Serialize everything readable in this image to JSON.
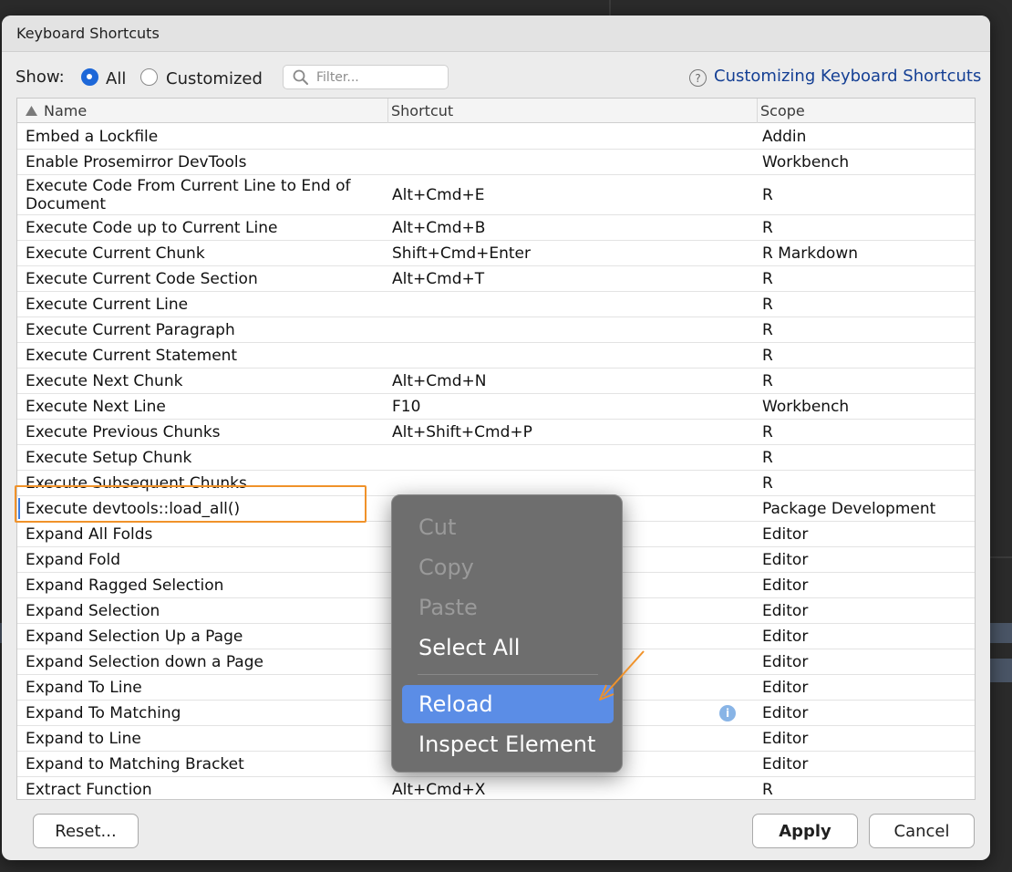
{
  "dialog": {
    "title": "Keyboard Shortcuts"
  },
  "toolbar": {
    "show_label": "Show:",
    "radio_all": "All",
    "radio_customized": "Customized",
    "filter_placeholder": "Filter...",
    "help_link": "Customizing Keyboard Shortcuts"
  },
  "table": {
    "columns": [
      "Name",
      "Shortcut",
      "Scope"
    ],
    "rows": [
      {
        "name": "Embed a Lockfile",
        "shortcut": "",
        "scope": "Addin"
      },
      {
        "name": "Enable Prosemirror DevTools",
        "shortcut": "",
        "scope": "Workbench"
      },
      {
        "name": "Execute Code From Current Line to End of Document",
        "shortcut": "Alt+Cmd+E",
        "scope": "R"
      },
      {
        "name": "Execute Code up to Current Line",
        "shortcut": "Alt+Cmd+B",
        "scope": "R"
      },
      {
        "name": "Execute Current Chunk",
        "shortcut": "Shift+Cmd+Enter",
        "scope": "R Markdown"
      },
      {
        "name": "Execute Current Code Section",
        "shortcut": "Alt+Cmd+T",
        "scope": "R"
      },
      {
        "name": "Execute Current Line",
        "shortcut": "",
        "scope": "R"
      },
      {
        "name": "Execute Current Paragraph",
        "shortcut": "",
        "scope": "R"
      },
      {
        "name": "Execute Current Statement",
        "shortcut": "",
        "scope": "R"
      },
      {
        "name": "Execute Next Chunk",
        "shortcut": "Alt+Cmd+N",
        "scope": "R"
      },
      {
        "name": "Execute Next Line",
        "shortcut": "F10",
        "scope": "Workbench"
      },
      {
        "name": "Execute Previous Chunks",
        "shortcut": "Alt+Shift+Cmd+P",
        "scope": "R"
      },
      {
        "name": "Execute Setup Chunk",
        "shortcut": "",
        "scope": "R"
      },
      {
        "name": "Execute Subsequent Chunks",
        "shortcut": "",
        "scope": "R"
      },
      {
        "name": "Execute devtools::load_all()",
        "shortcut": "",
        "scope": "Package Development"
      },
      {
        "name": "Expand All Folds",
        "shortcut": "",
        "scope": "Editor"
      },
      {
        "name": "Expand Fold",
        "shortcut": "",
        "scope": "Editor"
      },
      {
        "name": "Expand Ragged Selection",
        "shortcut": "",
        "scope": "Editor"
      },
      {
        "name": "Expand Selection",
        "shortcut": "",
        "scope": "Editor"
      },
      {
        "name": "Expand Selection Up a Page",
        "shortcut": "",
        "scope": "Editor"
      },
      {
        "name": "Expand Selection down a Page",
        "shortcut": "",
        "scope": "Editor"
      },
      {
        "name": "Expand To Line",
        "shortcut": "",
        "scope": "Editor"
      },
      {
        "name": "Expand To Matching",
        "shortcut": "",
        "scope": "Editor"
      },
      {
        "name": "Expand to Line",
        "shortcut": "",
        "scope": "Editor"
      },
      {
        "name": "Expand to Matching Bracket",
        "shortcut": "",
        "scope": "Editor"
      },
      {
        "name": "Extract Function",
        "shortcut": "Alt+Cmd+X",
        "scope": "R"
      }
    ]
  },
  "context_menu": {
    "items": [
      {
        "label": "Cut",
        "disabled": true
      },
      {
        "label": "Copy",
        "disabled": true
      },
      {
        "label": "Paste",
        "disabled": true
      },
      {
        "label": "Select All",
        "disabled": false
      },
      {
        "label": "Reload",
        "disabled": false,
        "active": true
      },
      {
        "label": "Inspect Element",
        "disabled": false
      }
    ]
  },
  "buttons": {
    "reset": "Reset...",
    "apply": "Apply",
    "cancel": "Cancel"
  },
  "colors": {
    "annotation": "#f0922a",
    "accent": "#5b8de6",
    "link": "#143f94"
  }
}
